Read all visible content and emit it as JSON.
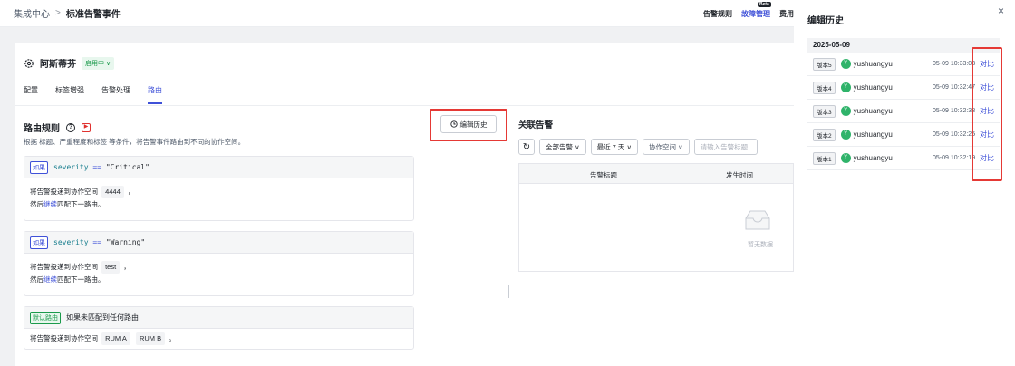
{
  "breadcrumb": {
    "parent": "集成中心",
    "separator": ">",
    "current": "标准告警事件"
  },
  "top_nav": {
    "items": [
      "告警规则",
      "故障管理",
      "费用"
    ],
    "beta_label": "Beta"
  },
  "header": {
    "name": "阿斯蒂芬",
    "status": "启用中 ∨"
  },
  "tabs": [
    "配置",
    "标签增强",
    "告警处理",
    "路由"
  ],
  "active_tab": "路由",
  "routing": {
    "title": "路由规则",
    "description": "根据 标题、严重程度和标签 等条件，将告警事件路由到不同的协作空间。",
    "rules": [
      {
        "tag": "如果",
        "field": "severity",
        "op": "==",
        "value": "\"Critical\"",
        "line1_prefix": "将告警投递到协作空间",
        "spaces": [
          "4444"
        ],
        "line1_suffix": "，",
        "line2_prefix": "然后",
        "line2_link": "继续",
        "line2_suffix": "匹配下一路由。"
      },
      {
        "tag": "如果",
        "field": "severity",
        "op": "==",
        "value": "\"Warning\"",
        "line1_prefix": "将告警投递到协作空间",
        "spaces": [
          "test"
        ],
        "line1_suffix": "，",
        "line2_prefix": "然后",
        "line2_link": "继续",
        "line2_suffix": "匹配下一路由。"
      }
    ],
    "default_rule": {
      "tag": "默认路由",
      "desc": "如果未匹配到任何路由",
      "line_prefix": "将告警投递到协作空间",
      "spaces": [
        "RUM A",
        "RUM B"
      ],
      "line_suffix": "。"
    },
    "edit_history_button": "编辑历史"
  },
  "related_alerts": {
    "title": "关联告警",
    "filters": [
      "全部告警 ∨",
      "最近 7 天 ∨",
      "协作空间 ∨"
    ],
    "search_placeholder": "请输入告警标题",
    "columns": [
      "告警标题",
      "发生时间"
    ],
    "empty_text": "暂无数据"
  },
  "drawer": {
    "title": "编辑历史",
    "date": "2025-05-09",
    "items": [
      {
        "version": "版本5",
        "user": "yushuangyu",
        "time": "05-09 10:33:03",
        "action": "对比"
      },
      {
        "version": "版本4",
        "user": "yushuangyu",
        "time": "05-09 10:32:47",
        "action": "对比"
      },
      {
        "version": "版本3",
        "user": "yushuangyu",
        "time": "05-09 10:32:38",
        "action": "对比"
      },
      {
        "version": "版本2",
        "user": "yushuangyu",
        "time": "05-09 10:32:25",
        "action": "对比"
      },
      {
        "version": "版本1",
        "user": "yushuangyu",
        "time": "05-09 10:32:19",
        "action": "对比"
      }
    ],
    "avatar_letter": "Y"
  },
  "colors": {
    "accent": "#3f51d8",
    "success": "#1a9a4b",
    "highlight": "#e53935"
  }
}
